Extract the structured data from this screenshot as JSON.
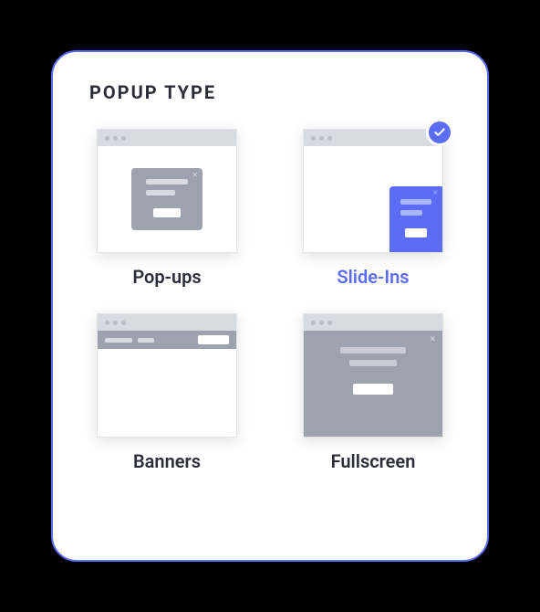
{
  "title": "POPUP TYPE",
  "options": [
    {
      "id": "popups",
      "label": "Pop-ups",
      "selected": false
    },
    {
      "id": "slideins",
      "label": "Slide-Ins",
      "selected": true
    },
    {
      "id": "banners",
      "label": "Banners",
      "selected": false
    },
    {
      "id": "fullscreen",
      "label": "Fullscreen",
      "selected": false
    }
  ],
  "colors": {
    "accent": "#5B6DF7",
    "gray": "#9DA2AF"
  }
}
